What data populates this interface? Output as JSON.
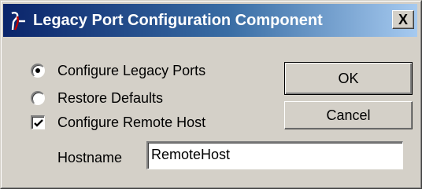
{
  "window": {
    "title": "Legacy Port Configuration Component",
    "close_glyph": "X",
    "icon": "app-icon"
  },
  "options": {
    "configure_legacy_ports": {
      "label": "Configure Legacy Ports",
      "selected": true
    },
    "restore_defaults": {
      "label": "Restore Defaults",
      "selected": false
    },
    "configure_remote_host": {
      "label": "Configure Remote Host",
      "checked": true
    }
  },
  "hostname": {
    "label": "Hostname",
    "value": "RemoteHost"
  },
  "buttons": {
    "ok": "OK",
    "cancel": "Cancel"
  },
  "colors": {
    "face": "#d4d0c8",
    "title_start": "#0a246a",
    "title_end": "#a6caf0"
  }
}
